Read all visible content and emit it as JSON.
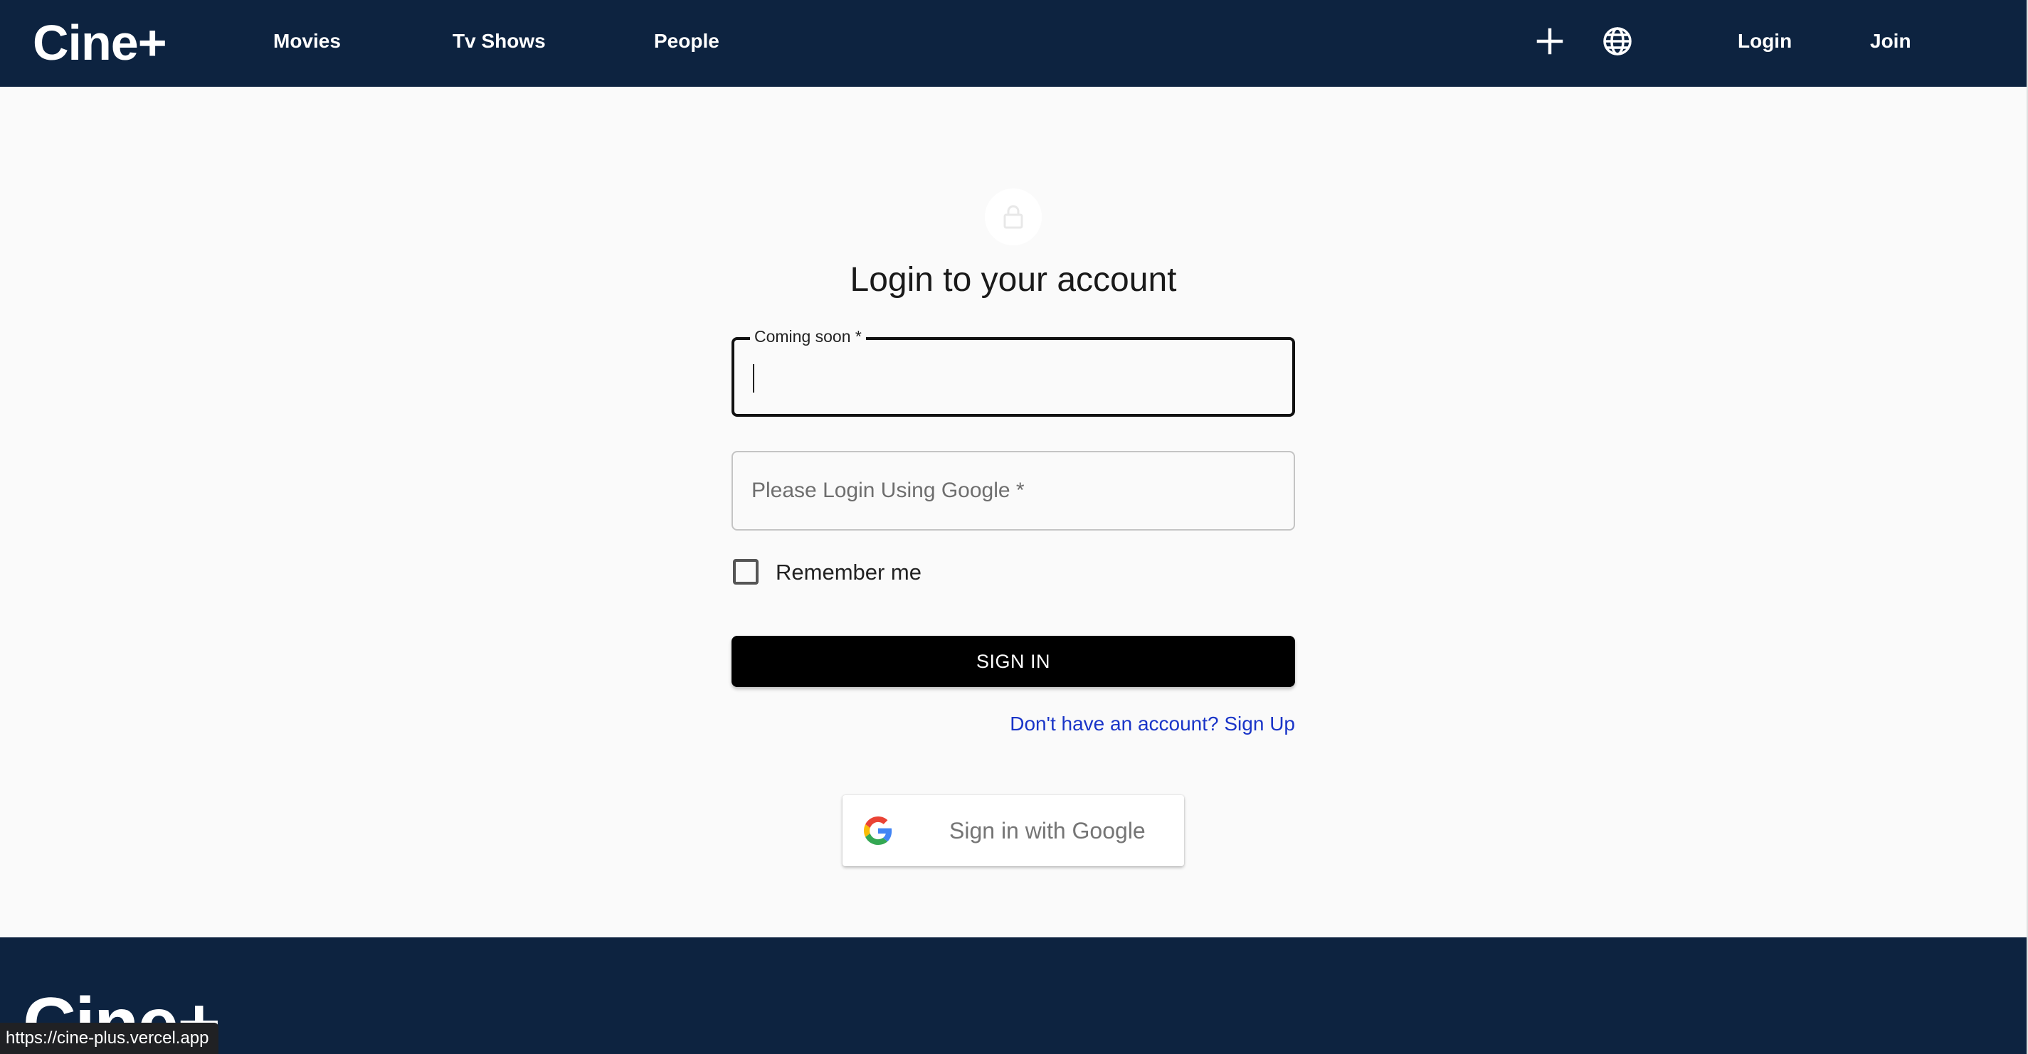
{
  "navbar": {
    "brand": "Cine+",
    "links": [
      {
        "label": "Movies"
      },
      {
        "label": "Tv Shows"
      },
      {
        "label": "People"
      }
    ],
    "icons": [
      "plus-icon",
      "globe-icon"
    ],
    "login_label": "Login",
    "join_label": "Join",
    "background": "#0d2340"
  },
  "login_form": {
    "lock_icon": "lock-icon",
    "title": "Login to your account",
    "field1": {
      "label": "Coming soon *",
      "value": ""
    },
    "field2": {
      "placeholder": "Please Login Using Google *",
      "value": ""
    },
    "remember_label": "Remember me",
    "remember_checked": false,
    "signin_label": "SIGN IN",
    "signup_link": "Don't have an account? Sign Up",
    "google_button_label": "Sign in with Google",
    "google_icon": "google-g-icon",
    "link_color": "#1a35c8"
  },
  "footer": {
    "brand": "Cine+"
  },
  "status_bar": {
    "url": "https://cine-plus.vercel.app"
  }
}
